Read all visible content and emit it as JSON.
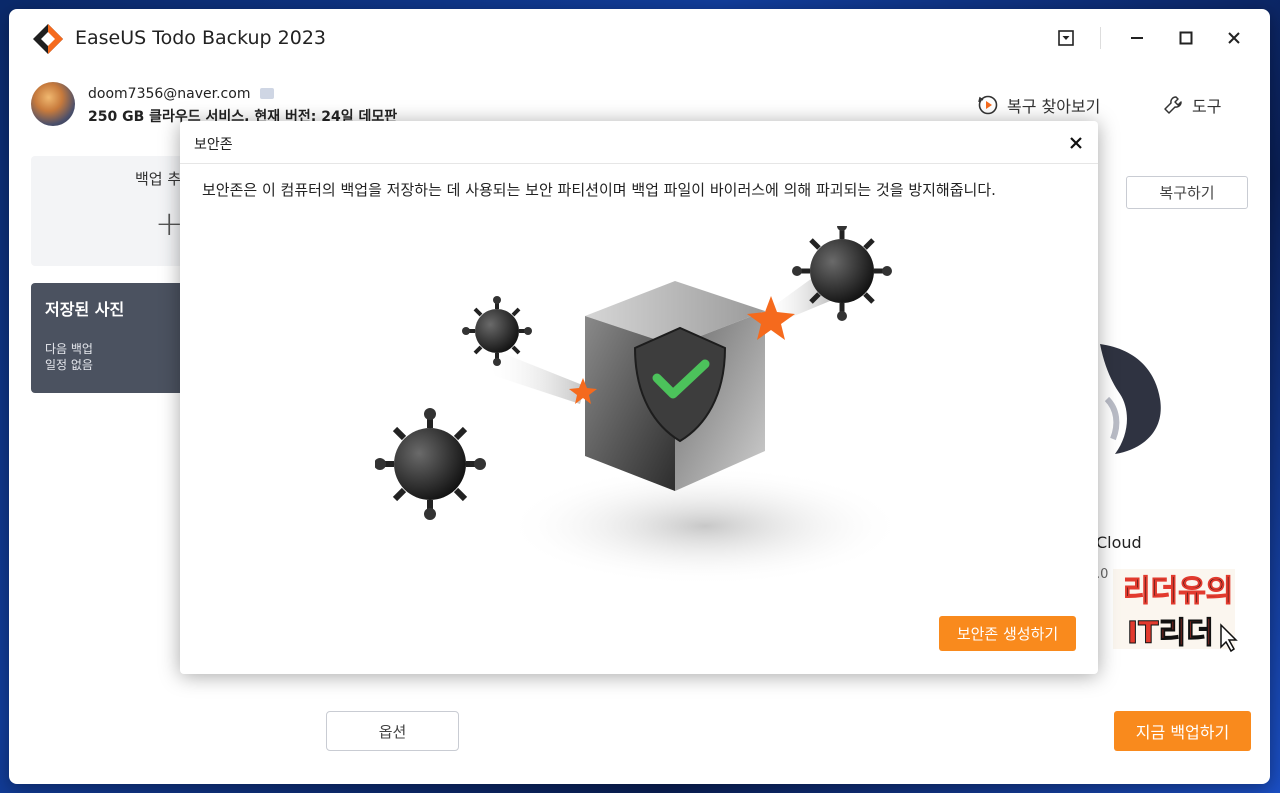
{
  "window": {
    "title": "EaseUS Todo Backup 2023"
  },
  "account": {
    "email": "doom7356@naver.com",
    "plan_info": "250 GB 클라우드 서비스, 현재 버전: 24일 데모판"
  },
  "header_links": {
    "browse_recovery": "복구 찾아보기",
    "tools": "도구"
  },
  "left_panel": {
    "new_backup_label": "백업 추",
    "task": {
      "title": "저장된 사진",
      "next_backup_line1": "다음 백업",
      "next_backup_line2": "일정 없음"
    }
  },
  "right_panel": {
    "restore_button": "복구하기",
    "cloud_label": "Cloud",
    "cloud_version": ".0"
  },
  "bottom": {
    "options_button": "옵션",
    "backup_now_button": "지금 백업하기"
  },
  "dialog": {
    "title": "보안존",
    "description": "보안존은 이 컴퓨터의 백업을 저장하는 데 사용되는 보안 파티션이며 백업 파일이 바이러스에 의해 파괴되는 것을 방지해줍니다.",
    "create_button": "보안존 생성하기"
  },
  "watermark": {
    "text_line1": "리더유의",
    "text_line2": "IT리더"
  },
  "colors": {
    "accent": "#f98a1d",
    "task_card": "#4b5260",
    "shield_check": "#4cc25b"
  }
}
